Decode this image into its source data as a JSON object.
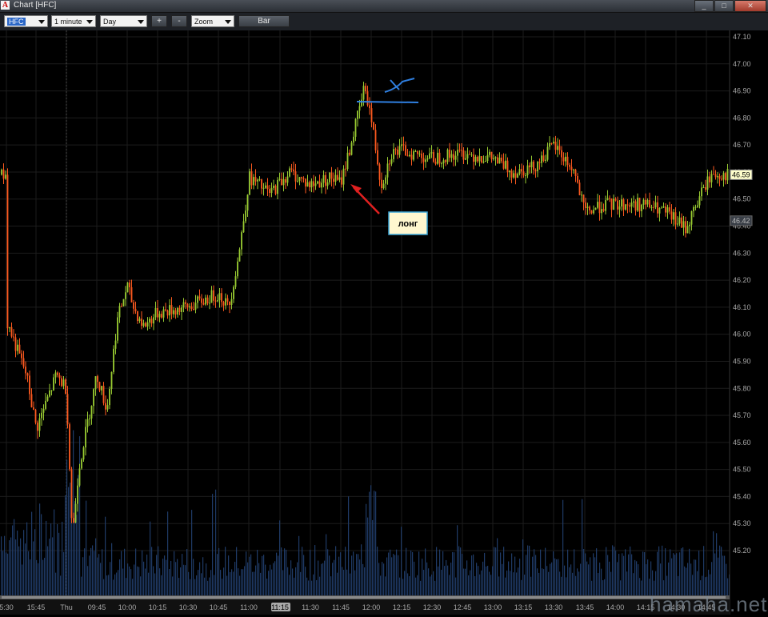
{
  "window": {
    "title": "Chart [HFC]",
    "app_icon_letter": "A",
    "buttons": [
      "_",
      "□",
      "✕"
    ]
  },
  "toolbar": {
    "symbol": "HFC",
    "interval": "1 minute",
    "range": "Day",
    "plus_label": "+",
    "minus_label": "-",
    "zoom_label": "Zoom",
    "bar_label": "Bar"
  },
  "chart_data": {
    "type": "candlestick",
    "symbol": "HFC",
    "y_ticks": [
      "47.10",
      "47.00",
      "46.90",
      "46.80",
      "46.70",
      "46.60",
      "46.50",
      "46.40",
      "46.30",
      "46.20",
      "46.10",
      "46.00",
      "45.90",
      "45.80",
      "45.70",
      "45.60",
      "45.50",
      "45.40",
      "45.30",
      "45.20"
    ],
    "x_ticks": [
      "5:30",
      "15:45",
      "Thu",
      "09:45",
      "10:00",
      "10:15",
      "10:30",
      "10:45",
      "11:00",
      "11:15",
      "11:30",
      "11:45",
      "12:00",
      "12:15",
      "12:30",
      "12:45",
      "13:00",
      "13:15",
      "13:30",
      "13:45",
      "14:00",
      "14:15",
      "14:30",
      "14:45"
    ],
    "highlighted_x_tick": "11:15",
    "ylim": [
      45.1,
      47.12
    ],
    "price_path": [
      [
        "15:30",
        46.05
      ],
      [
        "15:40",
        45.85
      ],
      [
        "15:45",
        45.65
      ],
      [
        "15:55",
        45.85
      ],
      [
        "Thu",
        45.8
      ],
      [
        "09:33",
        45.25
      ],
      [
        "09:36",
        45.5
      ],
      [
        "09:45",
        45.85
      ],
      [
        "09:50",
        45.72
      ],
      [
        "09:55",
        46.05
      ],
      [
        "10:00",
        46.18
      ],
      [
        "10:03",
        46.1
      ],
      [
        "10:08",
        46.03
      ],
      [
        "10:15",
        46.08
      ],
      [
        "10:30",
        46.1
      ],
      [
        "10:45",
        46.15
      ],
      [
        "10:50",
        46.1
      ],
      [
        "10:55",
        46.3
      ],
      [
        "11:00",
        46.58
      ],
      [
        "11:10",
        46.52
      ],
      [
        "11:20",
        46.6
      ],
      [
        "11:30",
        46.55
      ],
      [
        "11:40",
        46.58
      ],
      [
        "11:45",
        46.56
      ],
      [
        "11:50",
        46.7
      ],
      [
        "11:57",
        46.92
      ],
      [
        "12:00",
        46.8
      ],
      [
        "12:05",
        46.55
      ],
      [
        "12:10",
        46.67
      ],
      [
        "12:15",
        46.68
      ],
      [
        "12:30",
        46.65
      ],
      [
        "12:45",
        46.67
      ],
      [
        "13:00",
        46.65
      ],
      [
        "13:10",
        46.6
      ],
      [
        "13:20",
        46.62
      ],
      [
        "13:30",
        46.7
      ],
      [
        "13:40",
        46.6
      ],
      [
        "13:45",
        46.45
      ],
      [
        "13:55",
        46.48
      ],
      [
        "14:15",
        46.48
      ],
      [
        "14:25",
        46.45
      ],
      [
        "14:35",
        46.39
      ],
      [
        "14:40",
        46.48
      ],
      [
        "14:45",
        46.56
      ],
      [
        "14:48",
        46.59
      ]
    ],
    "last_price_label": "46.59",
    "marker_price_label": "46.42",
    "annotation": {
      "text": "лонг",
      "arrow_color": "#e02020"
    },
    "drawing_color": "#2f7fe0",
    "up_color": "#9acd32",
    "down_color": "#ff5a1f",
    "volume_color": "#1f3a66"
  },
  "watermark": "hamaha.net"
}
